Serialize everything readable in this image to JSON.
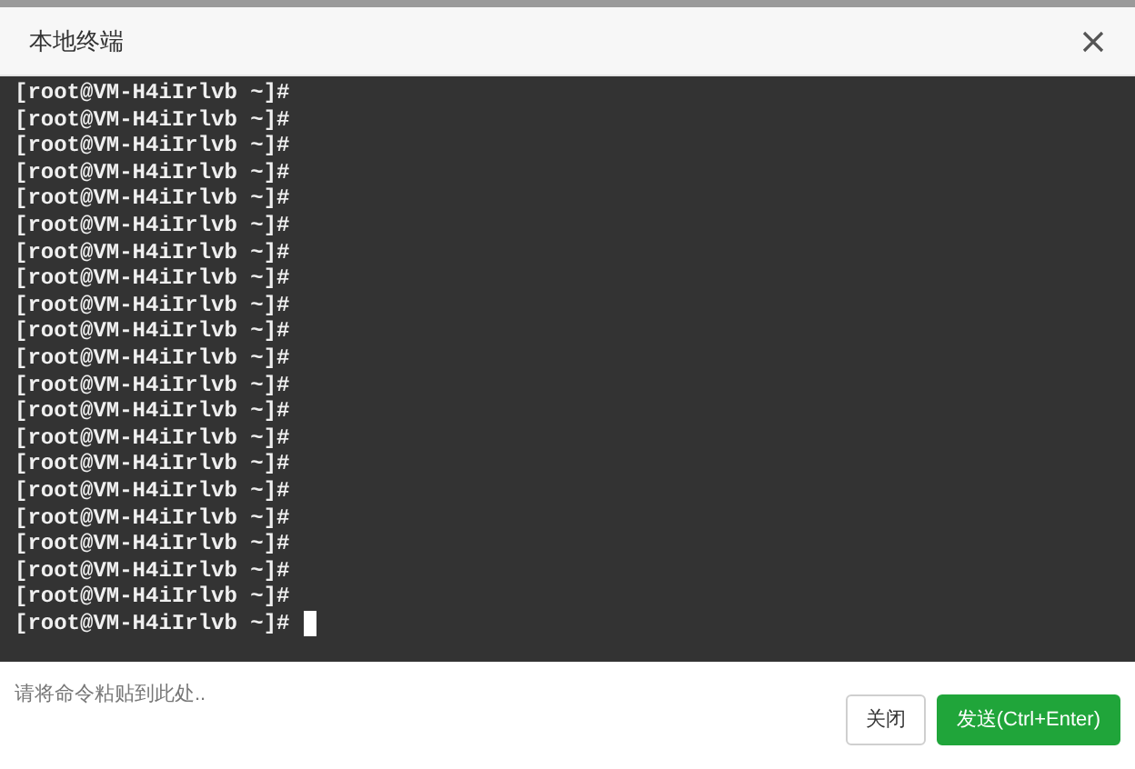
{
  "dialog": {
    "title": "本地终端"
  },
  "terminal": {
    "lines": [
      "[root@VM-H4iIrlvb ~]#",
      "[root@VM-H4iIrlvb ~]#",
      "[root@VM-H4iIrlvb ~]#",
      "[root@VM-H4iIrlvb ~]#",
      "[root@VM-H4iIrlvb ~]#",
      "[root@VM-H4iIrlvb ~]#",
      "[root@VM-H4iIrlvb ~]#",
      "[root@VM-H4iIrlvb ~]#",
      "[root@VM-H4iIrlvb ~]#",
      "[root@VM-H4iIrlvb ~]#",
      "[root@VM-H4iIrlvb ~]#",
      "[root@VM-H4iIrlvb ~]#",
      "[root@VM-H4iIrlvb ~]#",
      "[root@VM-H4iIrlvb ~]#",
      "[root@VM-H4iIrlvb ~]#",
      "[root@VM-H4iIrlvb ~]#",
      "[root@VM-H4iIrlvb ~]#",
      "[root@VM-H4iIrlvb ~]#",
      "[root@VM-H4iIrlvb ~]#",
      "[root@VM-H4iIrlvb ~]#",
      "[root@VM-H4iIrlvb ~]#"
    ]
  },
  "command_input": {
    "placeholder": "请将命令粘贴到此处.."
  },
  "buttons": [
    {
      "label": "关闭",
      "kind": "default"
    },
    {
      "label": "发送(Ctrl+Enter)",
      "kind": "primary"
    }
  ]
}
